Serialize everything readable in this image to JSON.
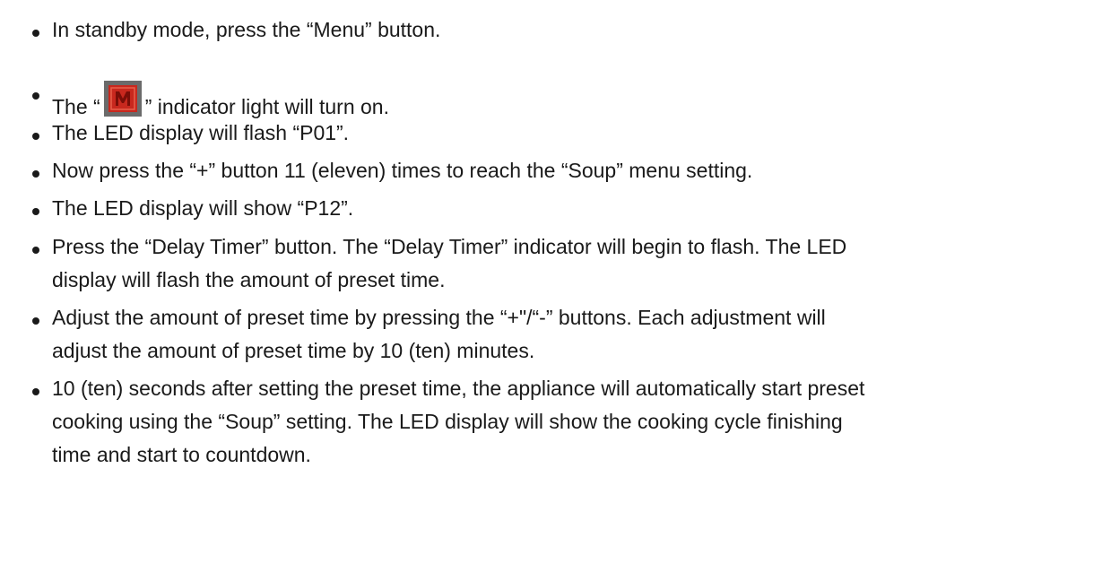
{
  "items": [
    {
      "lines": [
        "In standby mode, press the “Menu” button."
      ]
    },
    {
      "prefix": "The “",
      "icon": "menu-m-indicator-icon",
      "suffix": "” indicator light will turn on."
    },
    {
      "lines": [
        "The LED display will flash “P01”."
      ]
    },
    {
      "lines": [
        "Now press the “+” button 11 (eleven) times to reach the “Soup” menu setting."
      ]
    },
    {
      "lines": [
        "The LED display will show “P12”."
      ]
    },
    {
      "lines": [
        "Press the “Delay Timer” button.  The “Delay Timer” indicator will begin to flash.  The LED",
        "display will flash the amount of preset time."
      ]
    },
    {
      "lines": [
        "Adjust the amount of preset time by pressing the “+\"/“-” buttons.  Each adjustment will",
        "adjust the amount of preset time by 10 (ten) minutes."
      ]
    },
    {
      "lines": [
        "10 (ten) seconds after setting the preset time, the appliance will automatically start preset",
        "cooking using the “Soup” setting.  The LED display will show the cooking cycle finishing",
        "time and start to countdown."
      ]
    }
  ],
  "icon_colors": {
    "frame": "#6b6b6b",
    "background": "#c8281e",
    "letter": "#e03a2c"
  }
}
